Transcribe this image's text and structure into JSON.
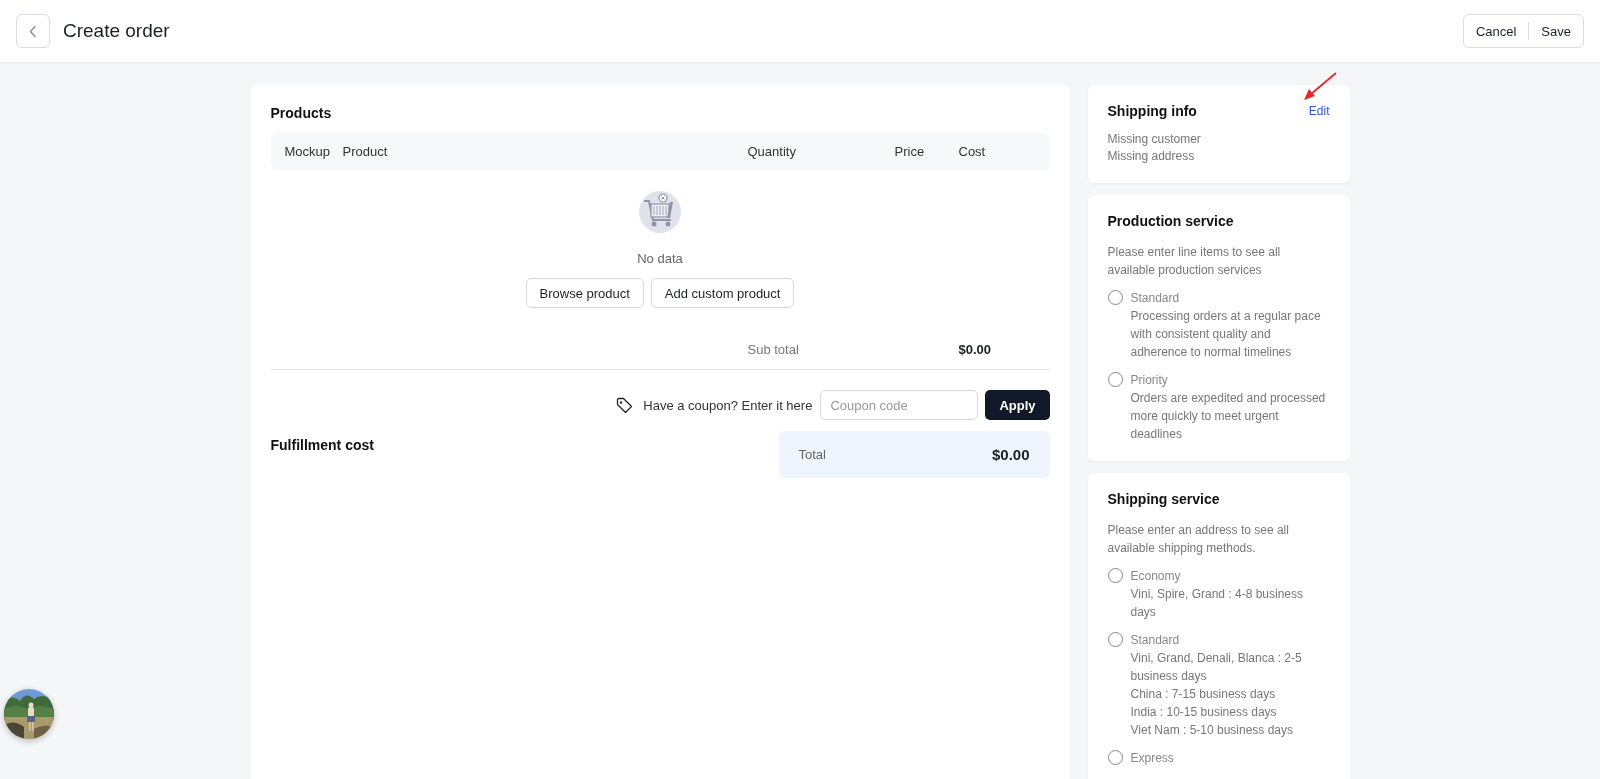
{
  "header": {
    "title": "Create order",
    "actions": [
      "Cancel",
      "Save"
    ]
  },
  "products": {
    "title": "Products",
    "columns": [
      "Mockup",
      "Product",
      "Quantity",
      "Price",
      "Cost"
    ],
    "empty_text": "No data",
    "buttons": [
      "Browse product",
      "Add custom product"
    ],
    "subtotal_label": "Sub total",
    "subtotal_value": "$0.00",
    "coupon_prompt": "Have a coupon? Enter it here",
    "coupon_placeholder": "Coupon code",
    "apply_button": "Apply"
  },
  "fulfillment": {
    "title": "Fulfillment cost",
    "total_label": "Total",
    "total_value": "$0.00"
  },
  "shipping_info": {
    "title": "Shipping info",
    "edit_link": "Edit",
    "lines": [
      "Missing customer",
      "Missing address"
    ]
  },
  "production_service": {
    "title": "Production service",
    "note": "Please enter line items to see all available production services",
    "options": [
      {
        "label": "Standard",
        "lines": [
          "Processing orders at a regular pace with consistent quality and adherence to normal timelines"
        ],
        "selected": false
      },
      {
        "label": "Priority",
        "lines": [
          "Orders are expedited and processed more quickly to meet urgent deadlines"
        ],
        "selected": false
      }
    ]
  },
  "shipping_service": {
    "title": "Shipping service",
    "note": "Please enter an address to see all available shipping methods.",
    "options": [
      {
        "label": "Economy",
        "lines": [
          "Vini, Spire, Grand : 4-8 business days"
        ],
        "selected": false
      },
      {
        "label": "Standard",
        "lines": [
          "Vini, Grand, Denali, Blanca : 2-5 business days",
          "China : 7-15 business days",
          "India : 10-15 business days",
          "Viet Nam : 5-10 business days"
        ],
        "selected": false
      },
      {
        "label": "Express",
        "selected": false
      }
    ]
  }
}
